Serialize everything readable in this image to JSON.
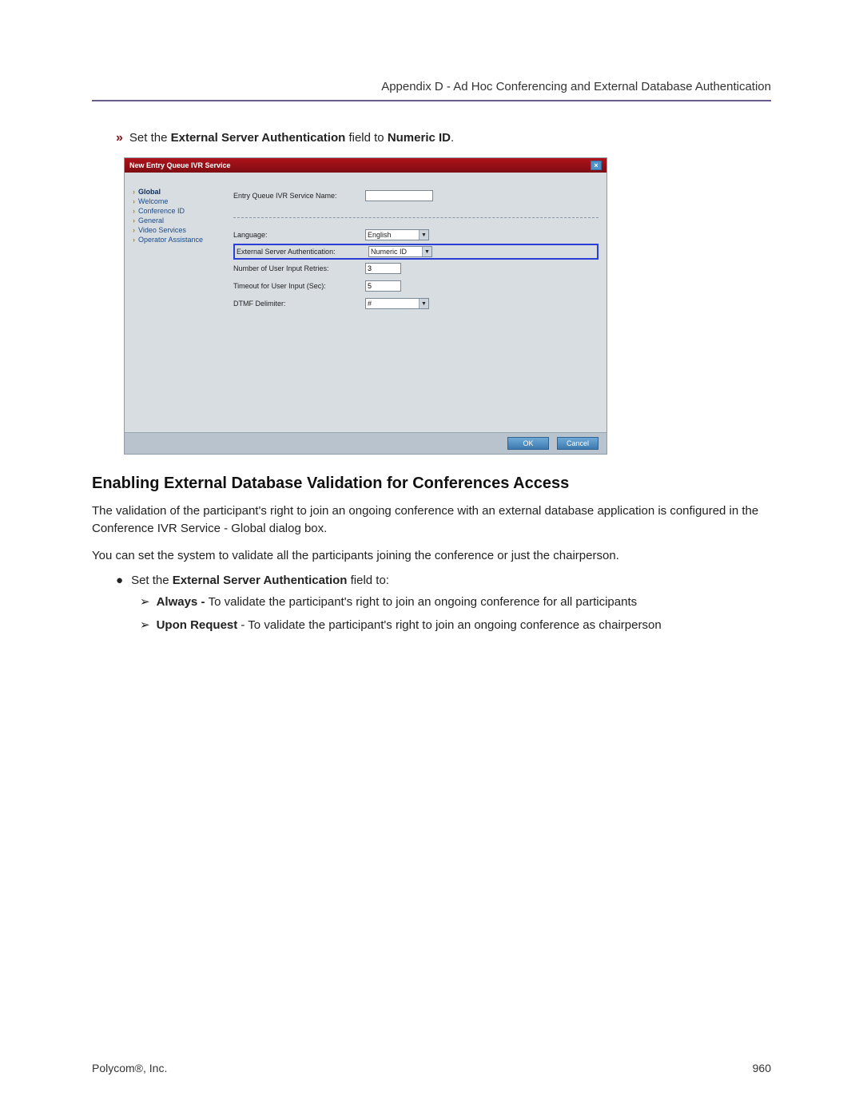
{
  "header": {
    "text": "Appendix D - Ad Hoc Conferencing and External Database Authentication"
  },
  "intro_bullet": {
    "marker": "»",
    "prefix": "Set the ",
    "bold1": "External Server Authentication",
    "mid": " field to ",
    "bold2": "Numeric ID",
    "suffix": "."
  },
  "dialog": {
    "title": "New Entry Queue IVR Service",
    "nav": [
      "Global",
      "Welcome",
      "Conference ID",
      "General",
      "Video Services",
      "Operator Assistance"
    ],
    "fields": {
      "service_name_label": "Entry Queue IVR Service Name:",
      "service_name_value": "",
      "language_label": "Language:",
      "language_value": "English",
      "ext_auth_label": "External Server Authentication:",
      "ext_auth_value": "Numeric ID",
      "retries_label": "Number of User Input Retries:",
      "retries_value": "3",
      "timeout_label": "Timeout for User Input (Sec):",
      "timeout_value": "5",
      "dtmf_label": "DTMF Delimiter:",
      "dtmf_value": "#"
    },
    "buttons": {
      "ok": "OK",
      "cancel": "Cancel"
    }
  },
  "section": {
    "title": "Enabling External Database Validation for Conferences Access",
    "para1": "The validation of the participant's right to join an ongoing conference with an external database application is configured in the Conference IVR Service - Global dialog box.",
    "para2": "You can set the system to validate all the participants joining the conference or just the chairperson.",
    "bullet1_prefix": "Set the ",
    "bullet1_bold": "External Server Authentication",
    "bullet1_suffix": " field to:",
    "arrow1_bold": "Always - ",
    "arrow1_text": "To validate the participant's right to join an ongoing conference for all participants",
    "arrow2_bold": "Upon Request",
    "arrow2_text": " - To validate the participant's right to join an ongoing conference as chairperson"
  },
  "footer": {
    "left": "Polycom®, Inc.",
    "right": "960"
  }
}
